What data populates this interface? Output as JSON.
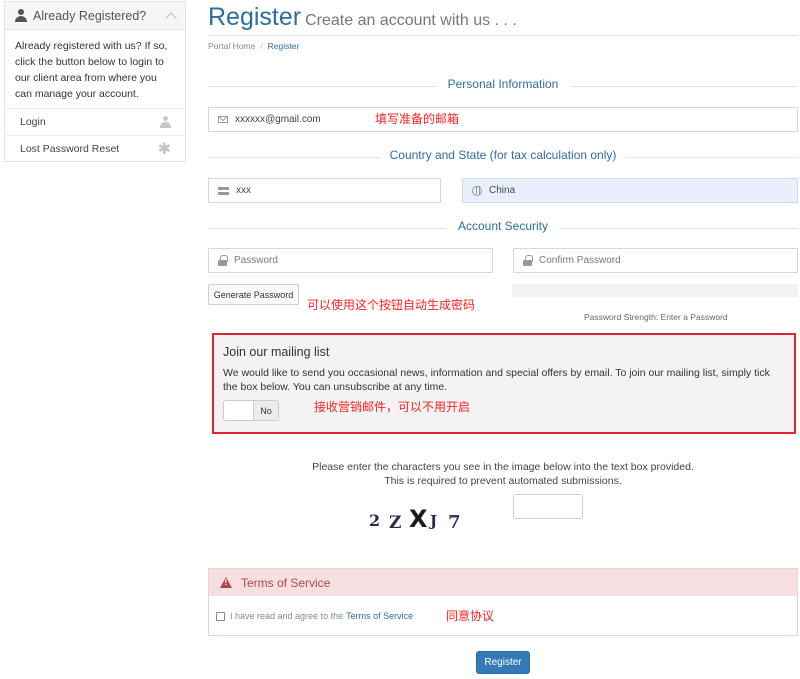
{
  "sidebar": {
    "title": "Already Registered?",
    "body": "Already registered with us? If so, click the button below to login to our client area from where you can manage your account.",
    "links": [
      {
        "label": "Login",
        "icon": "user-icon"
      },
      {
        "label": "Lost Password Reset",
        "icon": "asterisk-icon"
      }
    ]
  },
  "header": {
    "title": "Register",
    "subtitle": "Create an account with us . . .",
    "breadcrumb": [
      "Portal Home",
      "Register"
    ]
  },
  "personal": {
    "section_title": "Personal Information",
    "email_value": "xxxxxx@gmail.com",
    "email_annotation": "填写准备的邮箱"
  },
  "country": {
    "section_title": "Country and State (for tax calculation only)",
    "state_value": "xxx",
    "country_value": "China"
  },
  "security": {
    "section_title": "Account Security",
    "password_placeholder": "Password",
    "confirm_placeholder": "Confirm Password",
    "generate_label": "Generate Password",
    "generate_annotation": "可以使用这个按钮自动生成密码",
    "strength_text": "Password Strength: Enter a Password"
  },
  "mailing": {
    "title": "Join our mailing list",
    "description": "We would like to send you occasional news, information and special offers by email. To join our mailing list, simply tick the box below. You can unsubscribe at any time.",
    "toggle_state": "No",
    "annotation": "接收营销邮件，可以不用开启"
  },
  "captcha": {
    "line1": "Please enter the characters you see in the image below into the text box provided.",
    "line2": "This is required to prevent automated submissions.",
    "chars": [
      "2",
      "Z",
      "X",
      "J",
      "7"
    ]
  },
  "terms": {
    "title": "Terms of Service",
    "agree_prefix": "I have read and agree to the",
    "agree_link": "Terms of Service",
    "annotation": "同意协议"
  },
  "submit_label": "Register",
  "colors": {
    "brand_blue": "#2e6da4",
    "annotation_red": "#ff2222",
    "highlight_border": "#e0242a",
    "country_field_bg": "#e8f0fe"
  }
}
